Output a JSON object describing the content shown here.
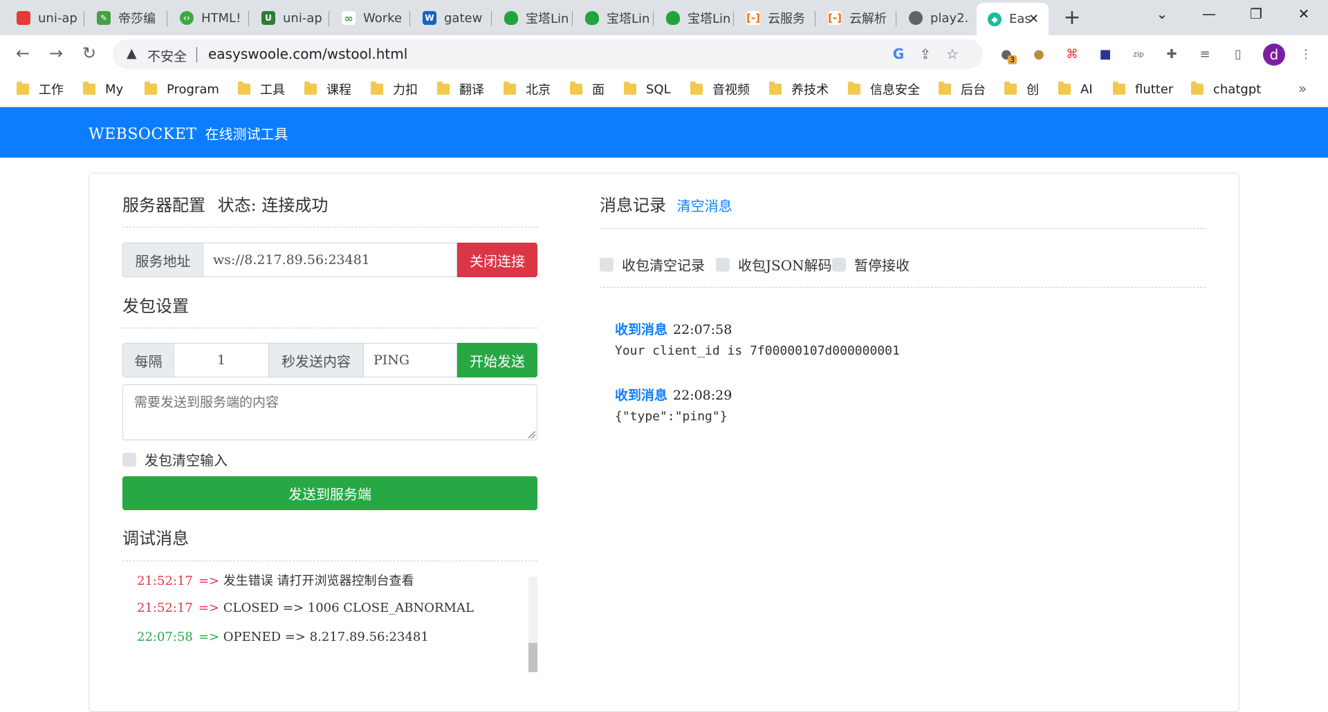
{
  "browser": {
    "tabs": [
      {
        "label": "uni-ap",
        "icon": "uniapp-red-icon",
        "color": "#e53935"
      },
      {
        "label": "帝莎编",
        "icon": "leaf-icon",
        "color": "#43a047"
      },
      {
        "label": "HTML!",
        "icon": "html-icon",
        "color": "#3caa3c"
      },
      {
        "label": "uni-ap",
        "icon": "uniapp-green-icon",
        "color": "#2e7d32"
      },
      {
        "label": "Worke",
        "icon": "worker-icon",
        "color": "#43a047"
      },
      {
        "label": "gatew",
        "icon": "gateway-icon",
        "color": "#1565c0"
      },
      {
        "label": "宝塔Lin",
        "icon": "baota-icon",
        "color": "#20a53a"
      },
      {
        "label": "宝塔Lin",
        "icon": "baota-icon",
        "color": "#20a53a"
      },
      {
        "label": "宝塔Lin",
        "icon": "baota-icon",
        "color": "#20a53a"
      },
      {
        "label": "云服务",
        "icon": "aliyun-icon",
        "color": "#ff6a00"
      },
      {
        "label": "云解析",
        "icon": "aliyun-icon",
        "color": "#ff6a00"
      },
      {
        "label": "play2.",
        "icon": "globe-icon",
        "color": "#5f6368"
      },
      {
        "label": "Eas",
        "icon": "easyswoole-icon",
        "color": "#1abc9c"
      }
    ],
    "address": {
      "security_label": "不安全",
      "url": "easyswoole.com/wstool.html"
    },
    "extension_badge": "3",
    "profile_initial": "d",
    "bookmarks": [
      "工作",
      "My",
      "Program",
      "工具",
      "课程",
      "力扣",
      "翻译",
      "北京",
      "面",
      "SQL",
      "音视频",
      "养技术",
      "信息安全",
      "后台",
      "创",
      "AI",
      "flutter",
      "chatgpt"
    ]
  },
  "page": {
    "brand_en": "WEBSOCKET",
    "brand_cn": "在线测试工具",
    "accent_color": "#0d7dff",
    "server": {
      "title": "服务器配置",
      "status": "状态: 连接成功",
      "address_label": "服务地址",
      "address_value": "ws://8.217.89.56:23481",
      "close_button": "关闭连接"
    },
    "send": {
      "title": "发包设置",
      "interval_label": "每隔",
      "interval_value": "1",
      "content_label": "秒发送内容",
      "content_value": "PING",
      "start_button": "开始发送",
      "textarea_placeholder": "需要发送到服务端的内容",
      "clear_input_label": "发包清空输入",
      "send_button": "发送到服务端"
    },
    "debug": {
      "title": "调试消息",
      "lines": [
        {
          "time": "21:52:17",
          "arrow": "=>",
          "text": "发生错误 请打开浏览器控制台查看",
          "color": "red"
        },
        {
          "time": "21:52:17",
          "arrow": "=>",
          "text": "CLOSED => 1006 CLOSE_ABNORMAL",
          "color": "red"
        },
        {
          "time": "22:07:58",
          "arrow": "=>",
          "text": "OPENED => 8.217.89.56:23481",
          "color": "green"
        }
      ]
    },
    "messages": {
      "title": "消息记录",
      "clear_link": "清空消息",
      "options": [
        "收包清空记录",
        "收包JSON解码",
        "暂停接收"
      ],
      "items": [
        {
          "label": "收到消息",
          "time": "22:07:58",
          "body": "Your client_id is 7f00000107d000000001"
        },
        {
          "label": "收到消息",
          "time": "22:08:29",
          "body": "{\"type\":\"ping\"}"
        }
      ]
    }
  }
}
